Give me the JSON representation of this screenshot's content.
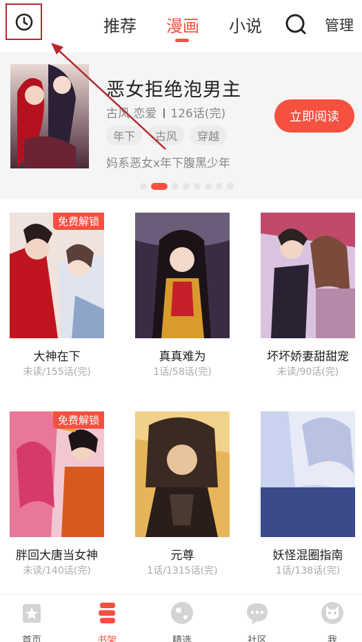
{
  "top_tabs": [
    {
      "label": "推荐",
      "active": false
    },
    {
      "label": "漫画",
      "active": true
    },
    {
      "label": "小说",
      "active": false
    }
  ],
  "manage_label": "管理",
  "icons": {
    "history": "clock-icon",
    "search": "search-icon"
  },
  "featured": {
    "title": "恶女拒绝泡男主",
    "genres": "古风 恋爱",
    "chapters": "126话(完)",
    "tags": [
      "年下",
      "古风",
      "穿越"
    ],
    "description": "妈系恶女x年下腹黑少年",
    "read_button": "立即阅读",
    "carousel_count": 8,
    "carousel_active_index": 1
  },
  "comics": [
    {
      "title": "大神在下",
      "progress": "未读/155话(完)",
      "badge": "免费解锁"
    },
    {
      "title": "真真难为",
      "progress": "1话/58话(完)",
      "badge": ""
    },
    {
      "title": "坏坏娇妻甜甜宠",
      "progress": "未读/90话(完)",
      "badge": ""
    },
    {
      "title": "胖回大唐当女神",
      "progress": "未读/140话(完)",
      "badge": "免费解锁"
    },
    {
      "title": "元尊",
      "progress": "1话/1315话(完)",
      "badge": ""
    },
    {
      "title": "妖怪混圈指南",
      "progress": "1话/138话(完)",
      "badge": ""
    }
  ],
  "bottom_nav": [
    {
      "label": "首页",
      "icon": "home-icon",
      "active": false
    },
    {
      "label": "书架",
      "icon": "bookshelf-icon",
      "active": true
    },
    {
      "label": "精选",
      "icon": "featured-icon",
      "active": false
    },
    {
      "label": "社区",
      "icon": "community-icon",
      "active": false
    },
    {
      "label": "我",
      "icon": "profile-icon",
      "active": false
    }
  ],
  "colors": {
    "accent": "#f55040",
    "annotation": "#b5282c"
  }
}
